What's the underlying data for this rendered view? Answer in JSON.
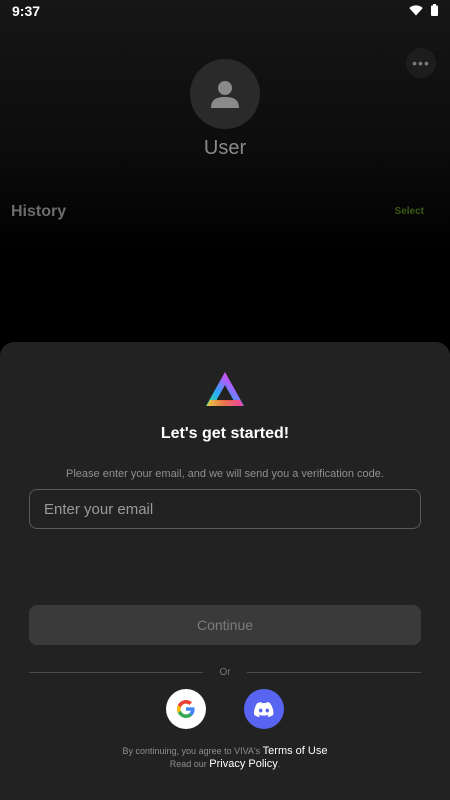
{
  "status_bar": {
    "time": "9:37",
    "icons": [
      "wifi-icon",
      "battery-icon"
    ]
  },
  "profile": {
    "more_icon": "more-horizontal-icon",
    "avatar_icon": "user-icon",
    "name": "User"
  },
  "history": {
    "title": "History",
    "select_label": "Select",
    "select_color": "#3b5a12"
  },
  "login_sheet": {
    "logo_icon": "viva-logo",
    "title": "Let's get started!",
    "subtitle": "Please enter your email, and we will send you a verification code.",
    "email_placeholder": "Enter your email",
    "email_value": "",
    "continue_label": "Continue",
    "divider_text": "Or",
    "social": [
      {
        "name": "Google",
        "icon": "google-icon"
      },
      {
        "name": "Discord",
        "icon": "discord-icon",
        "color": "#5865f2"
      }
    ],
    "legal_prefix": "By continuing, you agree to VIVA's",
    "terms_label": "Terms of Use",
    "legal_read": "Read our",
    "privacy_label": "Privacy Policy",
    "legal_suffix": "."
  }
}
